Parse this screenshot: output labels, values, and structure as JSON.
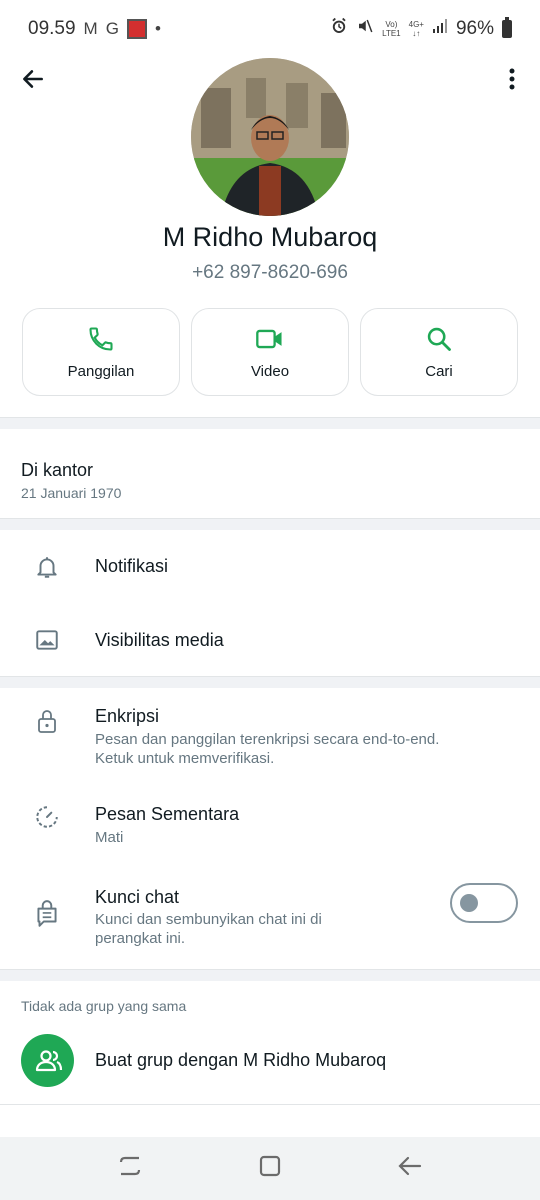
{
  "status_bar": {
    "time": "09.59",
    "mail_icon": "M",
    "google_icon": "G",
    "dot": "•",
    "signal_text_top": "Vo)",
    "signal_text_bottom": "LTE1",
    "network_top": "4G+",
    "network_bottom": "↓↑",
    "battery": "96%"
  },
  "contact": {
    "name": "M Ridho Mubaroq",
    "phone": "+62 897-8620-696"
  },
  "actions": [
    {
      "label": "Panggilan",
      "icon": "phone-icon"
    },
    {
      "label": "Video",
      "icon": "video-icon"
    },
    {
      "label": "Cari",
      "icon": "search-icon"
    }
  ],
  "about": {
    "text": "Di kantor",
    "date": "21 Januari 1970"
  },
  "settings": {
    "notifications": "Notifikasi",
    "media_visibility": "Visibilitas media"
  },
  "privacy": {
    "encryption_title": "Enkripsi",
    "encryption_sub": "Pesan dan panggilan terenkripsi secara end-to-end. Ketuk untuk memverifikasi.",
    "disappearing_title": "Pesan Sementara",
    "disappearing_sub": "Mati",
    "chat_lock_title": "Kunci chat",
    "chat_lock_sub": "Kunci dan sembunyikan chat ini di perangkat ini.",
    "chat_lock_enabled": false
  },
  "groups": {
    "header": "Tidak ada grup yang sama",
    "create_label": "Buat grup dengan M Ridho Mubaroq"
  },
  "colors": {
    "accent": "#1fa855",
    "text_primary": "#111b21",
    "text_secondary": "#667781"
  }
}
